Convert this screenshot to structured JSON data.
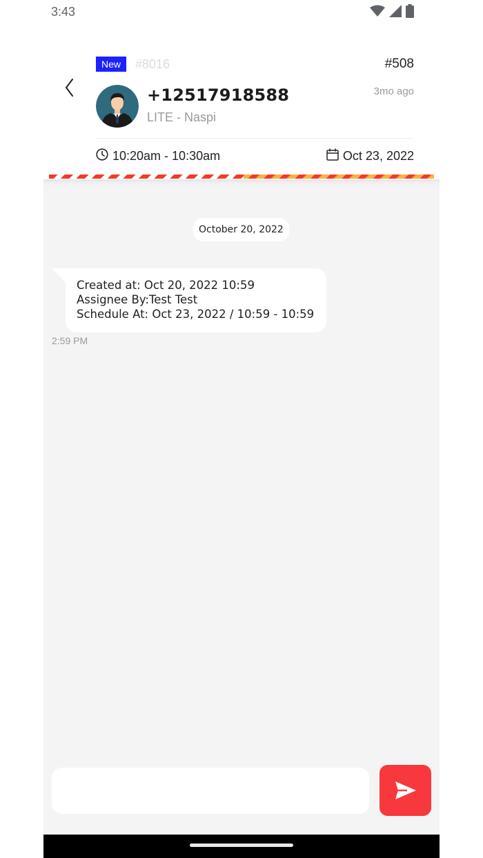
{
  "status_bar": {
    "time": "3:43",
    "icons": [
      "wifi-icon",
      "cellular-signal-icon",
      "battery-icon"
    ]
  },
  "header": {
    "badge": "New",
    "order_number": "#8016",
    "ticket_number": "#508",
    "phone": "+12517918588",
    "subtitle": "LITE - Naspi",
    "relative_time": "3mo ago",
    "time_range": "10:20am - 10:30am",
    "date": "Oct 23, 2022"
  },
  "chat": {
    "date_separator": "October 20, 2022",
    "messages": [
      {
        "lines": [
          "Created at: Oct 20, 2022 10:59",
          "Assignee By:Test Test",
          "Schedule At: Oct 23, 2022 / 10:59 - 10:59"
        ],
        "time": "2:59 PM"
      }
    ],
    "input": {
      "value": "",
      "placeholder": ""
    }
  },
  "colors": {
    "badge_blue": "#1a22ff",
    "send_red": "#f7383c",
    "stripe_red": "#f03a2e",
    "stripe_orange": "#f5a623",
    "chat_background": "#f4f4f4"
  }
}
